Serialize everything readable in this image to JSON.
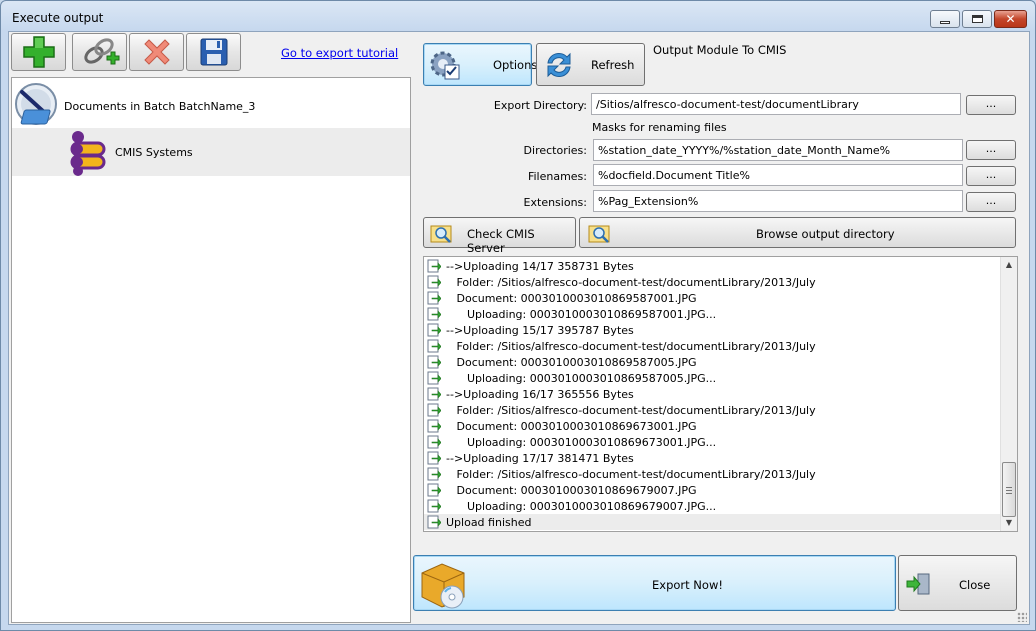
{
  "window": {
    "title": "Execute output"
  },
  "toolbar": {
    "tutorial_link": "Go to export tutorial"
  },
  "tree": {
    "root_label": "Documents in Batch BatchName_3",
    "child_label": "CMIS Systems"
  },
  "buttons": {
    "options": "Options",
    "refresh": "Refresh",
    "check_server": "Check CMIS Server",
    "browse": "Browse output directory",
    "export": "Export Now!",
    "close": "Close",
    "ellipsis": "..."
  },
  "module_title": "Output Module To CMIS",
  "form": {
    "export_dir_label": "Export Directory:",
    "export_dir_value": "/Sitios/alfresco-document-test/documentLibrary",
    "masks_label": "Masks for renaming files",
    "directories_label": "Directories:",
    "directories_value": "%station_date_YYYY%/%station_date_Month_Name%",
    "filenames_label": "Filenames:",
    "filenames_value": "%docfield.Document Title%",
    "extensions_label": "Extensions:",
    "extensions_value": "%Pag_Extension%"
  },
  "log": [
    "-->Uploading 14/17 358731 Bytes",
    "   Folder: /Sitios/alfresco-document-test/documentLibrary/2013/July",
    "   Document: 0003010003010869587001.JPG",
    "      Uploading: 0003010003010869587001.JPG...",
    "-->Uploading 15/17 395787 Bytes",
    "   Folder: /Sitios/alfresco-document-test/documentLibrary/2013/July",
    "   Document: 0003010003010869587005.JPG",
    "      Uploading: 0003010003010869587005.JPG...",
    "-->Uploading 16/17 365556 Bytes",
    "   Folder: /Sitios/alfresco-document-test/documentLibrary/2013/July",
    "   Document: 0003010003010869673001.JPG",
    "      Uploading: 0003010003010869673001.JPG...",
    "-->Uploading 17/17 381471 Bytes",
    "   Folder: /Sitios/alfresco-document-test/documentLibrary/2013/July",
    "   Document: 0003010003010869679007.JPG",
    "      Uploading: 0003010003010869679007.JPG...",
    "Upload finished"
  ],
  "icons": {
    "add": "plus-icon",
    "link": "add-link-icon",
    "delete": "delete-x-icon",
    "save": "floppy-disk-icon"
  }
}
